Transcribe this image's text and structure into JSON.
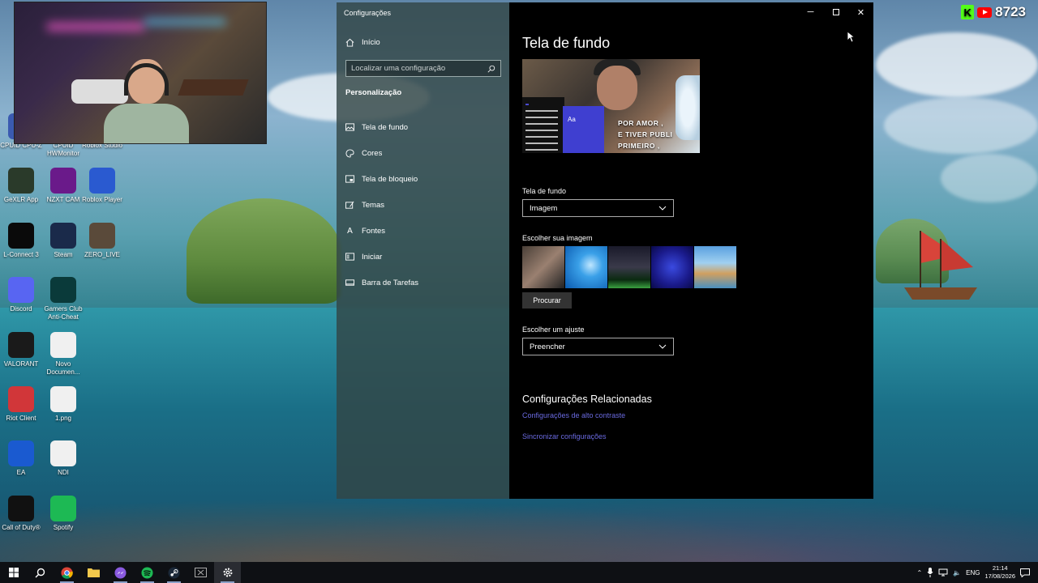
{
  "stream_overlay": {
    "viewer_count": "8723"
  },
  "desktop_icons": [
    {
      "label": "CPUID CPU-Z",
      "color": "#3a5ab0"
    },
    {
      "label": "CPUID HWMonitor",
      "color": "#2a7ab0"
    },
    {
      "label": "Roblox Studio",
      "color": "#2a6ad0"
    },
    {
      "label": "GeXLR App",
      "color": "#2a3a2a"
    },
    {
      "label": "NZXT CAM",
      "color": "#6a1a8a"
    },
    {
      "label": "Roblox Player",
      "color": "#2a5ad0"
    },
    {
      "label": "L-Connect 3",
      "color": "#0a0a0a"
    },
    {
      "label": "Steam",
      "color": "#1a2a4a"
    },
    {
      "label": "ZERO_LIVE",
      "color": "#5a4a3a"
    },
    {
      "label": "Discord",
      "color": "#5865f2"
    },
    {
      "label": "Gamers Club Anti-Cheat",
      "color": "#0a3a3a"
    },
    {
      "label": "VALORANT",
      "color": "#1a1a1a"
    },
    {
      "label": "Novo Documen...",
      "color": "#f0f0f0"
    },
    {
      "label": "Riot Client",
      "color": "#d13639"
    },
    {
      "label": "1.png",
      "color": "#f0f0f0"
    },
    {
      "label": "EA",
      "color": "#1a5ad0"
    },
    {
      "label": "NDI",
      "color": "#f0f0f0"
    },
    {
      "label": "Call of Duty®",
      "color": "#111111"
    },
    {
      "label": "Spotify",
      "color": "#1db954"
    }
  ],
  "window": {
    "title": "Configurações",
    "nav": {
      "home": "Início",
      "search_placeholder": "Localizar uma configuração",
      "section": "Personalização",
      "items": [
        {
          "label": "Tela de fundo",
          "icon": "image-icon"
        },
        {
          "label": "Cores",
          "icon": "palette-icon"
        },
        {
          "label": "Tela de bloqueio",
          "icon": "lock-screen-icon"
        },
        {
          "label": "Temas",
          "icon": "brush-icon"
        },
        {
          "label": "Fontes",
          "icon": "font-icon"
        },
        {
          "label": "Iniciar",
          "icon": "start-icon"
        },
        {
          "label": "Barra de Tarefas",
          "icon": "taskbar-icon"
        }
      ]
    },
    "main": {
      "title": "Tela de fundo",
      "preview": {
        "tile_label": "Aa",
        "overlay_text_1": "POR AMOR ,",
        "overlay_text_2": "E TIVER PUBLI",
        "overlay_text_3": "PRIMEIRO ,"
      },
      "background_label": "Tela de fundo",
      "background_value": "Imagem",
      "choose_image_label": "Escolher sua imagem",
      "browse_label": "Procurar",
      "fit_label": "Escolher um ajuste",
      "fit_value": "Preencher",
      "related_title": "Configurações Relacionadas",
      "links": [
        "Configurações de alto contraste",
        "Sincronizar configurações"
      ]
    }
  },
  "taskbar": {
    "tray_lang": "ENG",
    "time": "21:14",
    "date": "17/08/2026"
  },
  "colors": {
    "accent": "#4a4ad6",
    "link": "#6a6ae0"
  }
}
